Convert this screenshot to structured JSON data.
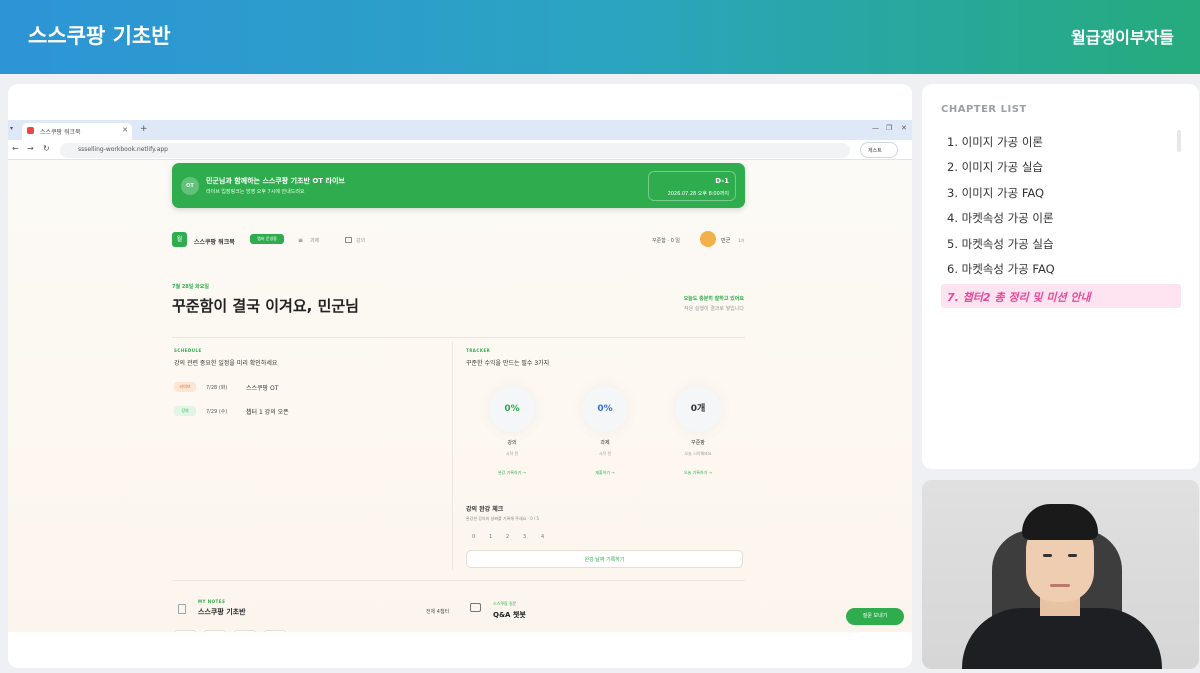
{
  "banner": {
    "title": "스스쿠팡 기초반",
    "brand": "월급쟁이부자들"
  },
  "browser": {
    "tab_title": "스스쿠팡 워크북",
    "url": "ssselling-workbook.netlify.app",
    "extension_label": "게스트"
  },
  "site": {
    "ot_banner": {
      "badge": "OT",
      "title": "민군님과 함께하는 스스쿠팡 기초반 OT 라이브",
      "subtitle": "라이브 입장링크는 방영 오후 7시에 안내드려요",
      "dday": "D-1",
      "datetime": "2026.07.28 오후 8:00까지"
    },
    "header": {
      "logo_text": "월",
      "site_name": "스스쿠팡 워크북",
      "badge": "멤버 운영중",
      "nav": [
        "과제",
        "강의"
      ],
      "streak": "꾸준함 · 0 일",
      "user_name": "민군",
      "user_grade": "1기"
    },
    "greeting": {
      "date": "7월 28일 화요일",
      "headline": "꾸준함이 결국 이겨요, 민군님",
      "right_line1": "오늘도 충분히 잘하고 있어요",
      "right_line2": "작은 실행이 결과로 쌓입니다"
    },
    "schedule": {
      "label": "SCHEDULE",
      "title": "강의 관련 중요한 일정을 미리 확인하세요",
      "items": [
        {
          "tag": "라이브",
          "date": "7/28 (화)",
          "title": "스스쿠팡 OT"
        },
        {
          "tag": "강의",
          "date": "7/29 (수)",
          "title": "챕터 1 강의 오픈"
        }
      ]
    },
    "tracker": {
      "label": "TRACKER",
      "title": "꾸준한 수익을 만드는 필수 3가지",
      "items": [
        {
          "value": "0%",
          "label": "강의",
          "sub": "시작 전",
          "link": "완강 기록하기 →",
          "color": "#2fad4e"
        },
        {
          "value": "0%",
          "label": "과제",
          "sub": "시작 전",
          "link": "제출하기 →",
          "color": "#3b6fd8"
        },
        {
          "value": "0개",
          "label": "꾸준팡",
          "sub": "오늘 시작해봐요",
          "link": "오늘 기록하기 →",
          "color": "#333333"
        }
      ]
    },
    "lecture_check": {
      "title": "강의 완강 체크",
      "subtitle": "완강한 강의의 날짜를 기록해 주세요 · 0 / 5",
      "numbers": [
        "0",
        "1",
        "2",
        "3",
        "4"
      ],
      "button": "완강 날짜 기록하기"
    },
    "notes": {
      "label": "MY NOTES",
      "title": "스스쿠팡 기초반",
      "count": "전체 4챕터"
    },
    "qa": {
      "label": "스스쿠팡 질문",
      "title": "Q&A 챗봇"
    },
    "question_button": "질문 보내기"
  },
  "chapter_list": {
    "header": "CHAPTER LIST",
    "items": [
      "1. 이미지 가공 이론",
      "2. 이미지 가공 실습",
      "3. 이미지 가공 FAQ",
      "4. 마켓속성 가공 이론",
      "5. 마켓속성 가공 실습",
      "6. 마켓속성 가공 FAQ"
    ],
    "active_item": "7. 챕터2 총 정리 및 미션 안내",
    "active_color": "#ec4899"
  },
  "colors": {
    "brand_green": "#2fad4e",
    "banner_start": "#2d94d6",
    "banner_end": "#25ab7c"
  }
}
